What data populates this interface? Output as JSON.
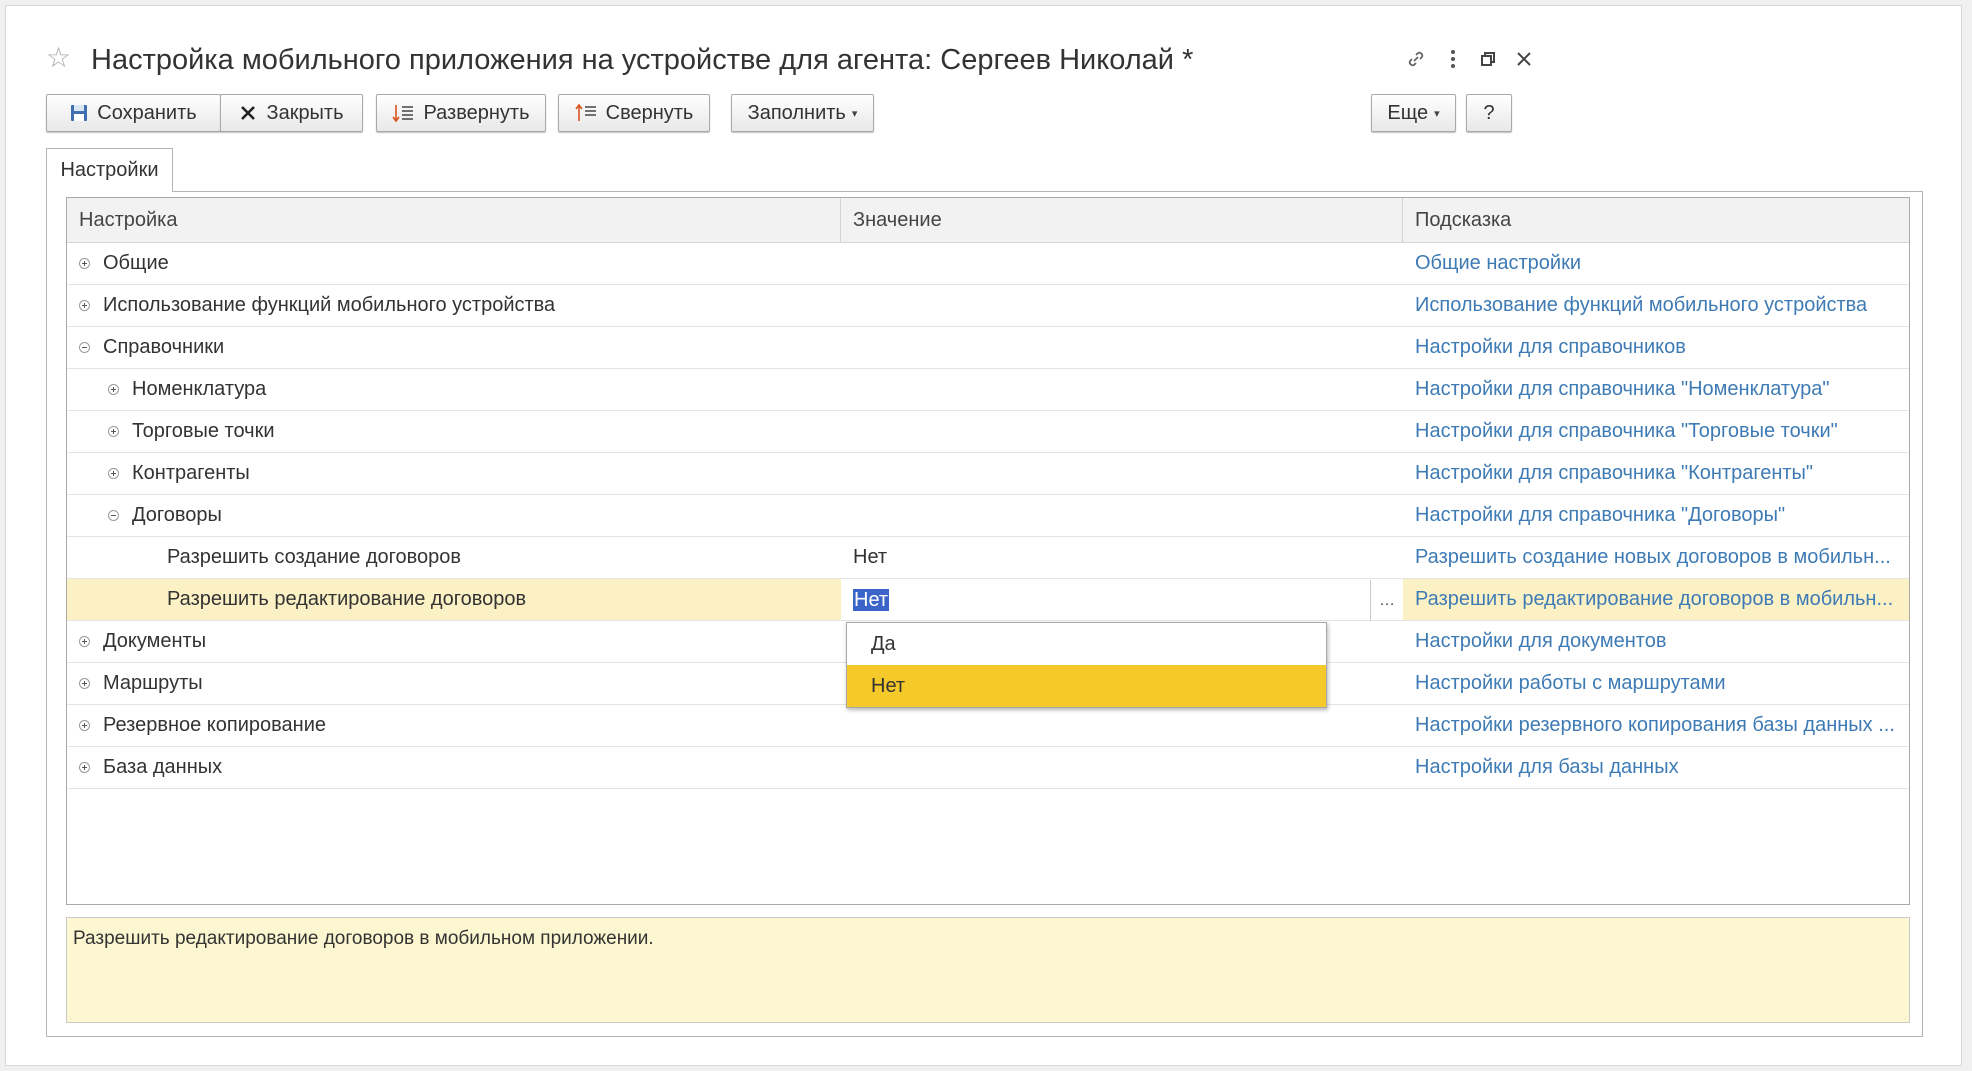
{
  "window": {
    "title": "Настройка мобильного приложения на устройстве для агента: Сергеев Николай *",
    "controls": [
      "link-icon",
      "more-vertical-icon",
      "restore-icon",
      "close-icon"
    ]
  },
  "toolbar": {
    "save_label": "Сохранить",
    "close_label": "Закрыть",
    "expand_label": "Развернуть",
    "collapse_label": "Свернуть",
    "fill_label": "Заполнить",
    "more_label": "Еще",
    "help_label": "?"
  },
  "tabs": [
    {
      "label": "Настройки",
      "active": true
    }
  ],
  "table": {
    "columns": [
      "Настройка",
      "Значение",
      "Подсказка"
    ],
    "rows": [
      {
        "name": "Общие",
        "level": 0,
        "toggle": "plus",
        "value": "",
        "hint": "Общие настройки"
      },
      {
        "name": "Использование функций мобильного устройства",
        "level": 0,
        "toggle": "plus",
        "value": "",
        "hint": "Использование функций мобильного устройства"
      },
      {
        "name": "Справочники",
        "level": 0,
        "toggle": "minus",
        "value": "",
        "hint": "Настройки для справочников"
      },
      {
        "name": "Номенклатура",
        "level": 1,
        "toggle": "plus",
        "value": "",
        "hint": "Настройки для справочника \"Номенклатура\""
      },
      {
        "name": "Торговые точки",
        "level": 1,
        "toggle": "plus",
        "value": "",
        "hint": "Настройки для справочника \"Торговые точки\""
      },
      {
        "name": "Контрагенты",
        "level": 1,
        "toggle": "plus",
        "value": "",
        "hint": "Настройки для справочника \"Контрагенты\""
      },
      {
        "name": "Договоры",
        "level": 1,
        "toggle": "minus",
        "value": "",
        "hint": "Настройки для справочника \"Договоры\""
      },
      {
        "name": "Разрешить создание договоров",
        "level": 2,
        "toggle": "none",
        "value": "Нет",
        "hint": "Разрешить создание новых договоров в мобильн..."
      },
      {
        "name": "Разрешить редактирование договоров",
        "level": 2,
        "toggle": "none",
        "value": "Нет",
        "hint": "Разрешить редактирование договоров в мобильн...",
        "current": true,
        "editing": true
      },
      {
        "name": "Документы",
        "level": 0,
        "toggle": "plus",
        "value": "",
        "hint": "Настройки для документов"
      },
      {
        "name": "Маршруты",
        "level": 0,
        "toggle": "plus",
        "value": "",
        "hint": "Настройки работы с маршрутами"
      },
      {
        "name": "Резервное копирование",
        "level": 0,
        "toggle": "plus",
        "value": "",
        "hint": "Настройки резервного копирования базы данных ..."
      },
      {
        "name": "База данных",
        "level": 0,
        "toggle": "plus",
        "value": "",
        "hint": "Настройки для базы данных"
      }
    ]
  },
  "dropdown": {
    "options": [
      "Да",
      "Нет"
    ],
    "highlighted": "Нет"
  },
  "info_text": "Разрешить редактирование договоров в мобильном приложении.",
  "colors": {
    "link": "#3e7bb5",
    "current_row": "#fcf0c5",
    "dropdown_highlight": "#f6c92a",
    "info_background": "#fdf7d1",
    "selection": "#3a64c8"
  }
}
